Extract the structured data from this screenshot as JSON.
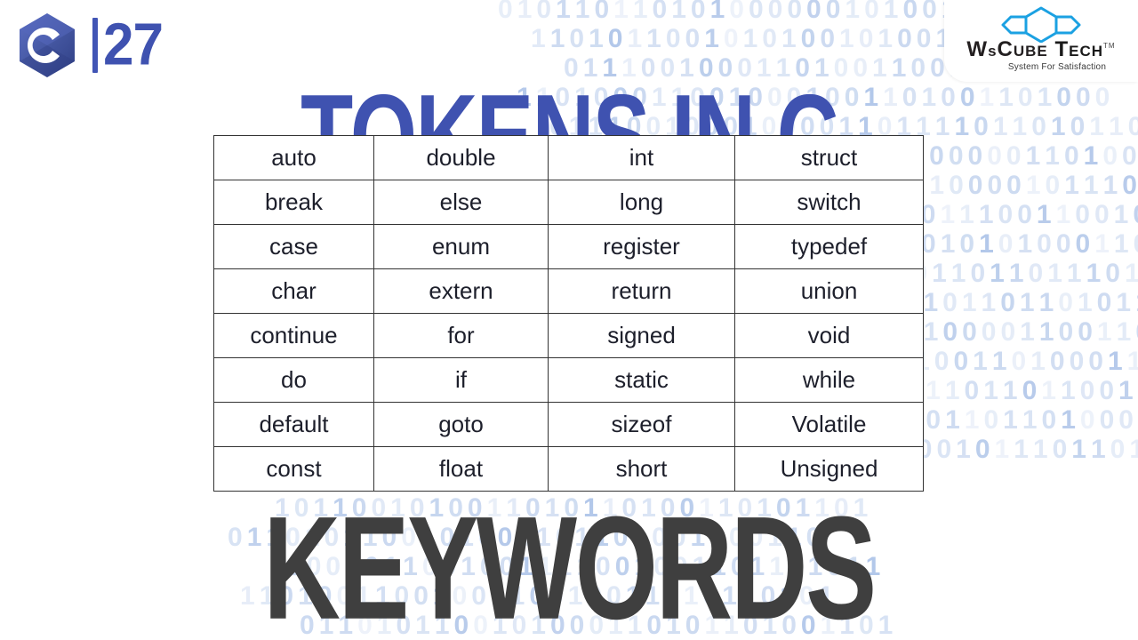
{
  "slide": {
    "background_color": "#ffffff",
    "title": "TOKENS IN C",
    "title_color": "#3f52b0",
    "caption": "KEYWORDS",
    "caption_color": "#3f3f3f"
  },
  "header": {
    "c_logo_name": "c-language-logo",
    "c_logo_letter": "C",
    "episode_number": "27",
    "episode_separator": "|",
    "accent_color": "#3f52b0"
  },
  "brand": {
    "name_part1": "W",
    "name_part2": "s",
    "name_part3": "C",
    "name_part4": "UBE",
    "name_part5": "T",
    "name_part6": "ECH",
    "full_name": "WsCube Tech",
    "trademark": "TM",
    "tagline": "System For Satisfaction",
    "hex_color": "#1ba1e2",
    "text_color": "#231f20"
  },
  "background": {
    "binary_color": "#c9d8f0",
    "binary_rows": [
      "0101101101010000001010011001010",
      "1101011001010100101001101011010",
      "0111001000110100110011010010011",
      "1101000110010001001101001101000",
      "0111001000100001101111011010110",
      "1100100000011010010011010110101",
      "0110000101110010100011011101101",
      "0101011100110010110100011010011",
      "0101010001101001001101011001101",
      "1001101101110110100110100110010",
      "0110110110110101101001101101001",
      "0100001100110101101011010011011",
      "1101001101000110011010110010110",
      "0011001101101100101101001101101",
      "0101101101000110100110100110100",
      "0100001011101101011010011011010",
      "1101101010011010011011010010110",
      "1011001010011010110100110101101",
      "0110101100101001101101001100110",
      "0001011001001111001001101101011",
      "1101001100100110010011010110101",
      "0110101100101000110101101001101"
    ]
  },
  "keywords_table": {
    "name": "c-keywords-table",
    "columns": 4,
    "rows": [
      [
        "auto",
        "double",
        "int",
        "struct"
      ],
      [
        "break",
        "else",
        "long",
        "switch"
      ],
      [
        "case",
        "enum",
        "register",
        "typedef"
      ],
      [
        "char",
        "extern",
        "return",
        "union"
      ],
      [
        "continue",
        "for",
        "signed",
        "void"
      ],
      [
        "do",
        "if",
        "static",
        "while"
      ],
      [
        "default",
        "goto",
        "sizeof",
        "Volatile"
      ],
      [
        "const",
        "float",
        "short",
        "Unsigned"
      ]
    ],
    "border_color": "#333333",
    "cell_text_color": "#1d1f2b"
  }
}
